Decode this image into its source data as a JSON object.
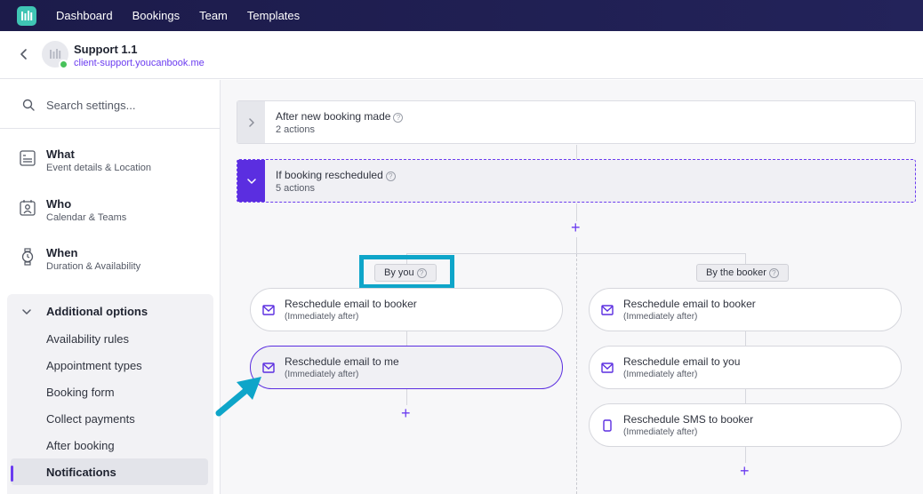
{
  "nav": {
    "items": [
      "Dashboard",
      "Bookings",
      "Team",
      "Templates"
    ]
  },
  "header": {
    "title": "Support 1.1",
    "link": "client-support.youcanbook.me"
  },
  "sidebar": {
    "search_placeholder": "Search settings...",
    "sections": [
      {
        "title": "What",
        "sub": "Event details & Location",
        "icon": "list-icon"
      },
      {
        "title": "Who",
        "sub": "Calendar & Teams",
        "icon": "person-icon"
      },
      {
        "title": "When",
        "sub": "Duration & Availability",
        "icon": "watch-icon"
      }
    ],
    "additional": {
      "title": "Additional options",
      "items": [
        "Availability rules",
        "Appointment types",
        "Booking form",
        "Collect payments",
        "After booking",
        "Notifications"
      ],
      "active": "Notifications"
    }
  },
  "main": {
    "triggers": [
      {
        "title": "After new booking made",
        "sub": "2 actions",
        "state": "collapsed"
      },
      {
        "title": "If booking rescheduled",
        "sub": "5 actions",
        "state": "expanded"
      }
    ],
    "branches": [
      {
        "label": "By you",
        "actions": [
          {
            "title": "Reschedule email to booker",
            "sub": "(Immediately after)",
            "icon": "mail-icon"
          },
          {
            "title": "Reschedule email to me",
            "sub": "(Immediately after)",
            "icon": "mail-icon"
          }
        ]
      },
      {
        "label": "By the booker",
        "actions": [
          {
            "title": "Reschedule email to booker",
            "sub": "(Immediately after)",
            "icon": "mail-icon"
          },
          {
            "title": "Reschedule email to you",
            "sub": "(Immediately after)",
            "icon": "mail-icon"
          },
          {
            "title": "Reschedule SMS to booker",
            "sub": "(Immediately after)",
            "icon": "phone-icon"
          }
        ]
      }
    ],
    "plus_symbol": "+"
  },
  "colors": {
    "accent": "#6b3cf0",
    "nav_bg": "#1c1b4a",
    "highlight": "#0ea5c9",
    "logo": "#3fc5b4"
  }
}
